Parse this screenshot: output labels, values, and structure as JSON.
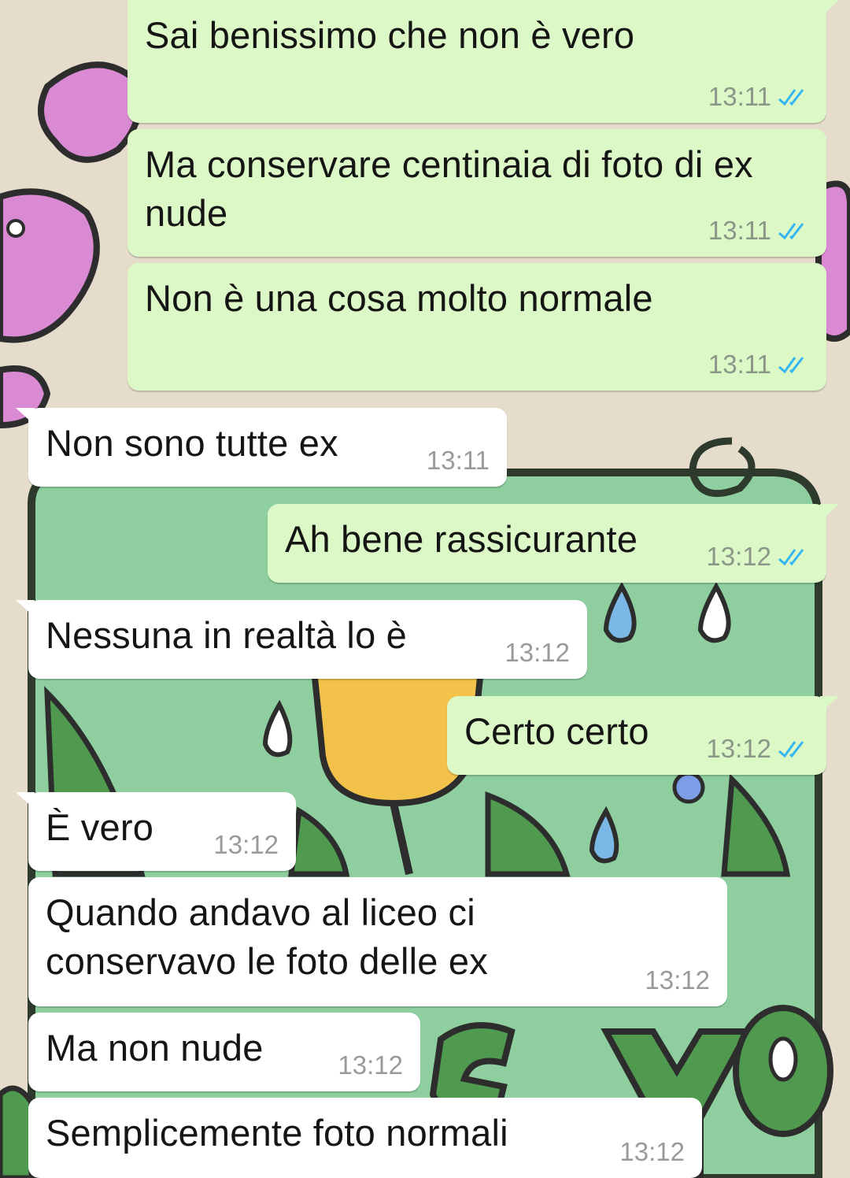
{
  "colors": {
    "outgoing_bubble": "#dcf8c6",
    "incoming_bubble": "#ffffff",
    "read_ticks": "#34b7f1",
    "wallpaper": "#e6dccb"
  },
  "messages": [
    {
      "id": "m1",
      "direction": "out",
      "text": "Sai benissimo che non è vero",
      "time": "13:11",
      "status": "read"
    },
    {
      "id": "m2",
      "direction": "out",
      "text": "Ma conservare centinaia di foto di ex nude",
      "time": "13:11",
      "status": "read"
    },
    {
      "id": "m3",
      "direction": "out",
      "text": "Non è una cosa molto normale",
      "time": "13:11",
      "status": "read"
    },
    {
      "id": "m4",
      "direction": "in",
      "text": "Non sono tutte ex",
      "time": "13:11"
    },
    {
      "id": "m5",
      "direction": "out",
      "text": "Ah bene rassicurante",
      "time": "13:12",
      "status": "read"
    },
    {
      "id": "m6",
      "direction": "in",
      "text": "Nessuna in realtà lo è",
      "time": "13:12"
    },
    {
      "id": "m7",
      "direction": "out",
      "text": "Certo certo",
      "time": "13:12",
      "status": "read"
    },
    {
      "id": "m8",
      "direction": "in",
      "text": "È vero",
      "time": "13:12"
    },
    {
      "id": "m9",
      "direction": "in",
      "text": "Quando andavo al liceo ci conservavo le foto delle ex",
      "time": "13:12"
    },
    {
      "id": "m10",
      "direction": "in",
      "text": "Ma non nude",
      "time": "13:12"
    },
    {
      "id": "m11",
      "direction": "in",
      "text": "Semplicemente foto normali",
      "time": "13:12"
    }
  ]
}
